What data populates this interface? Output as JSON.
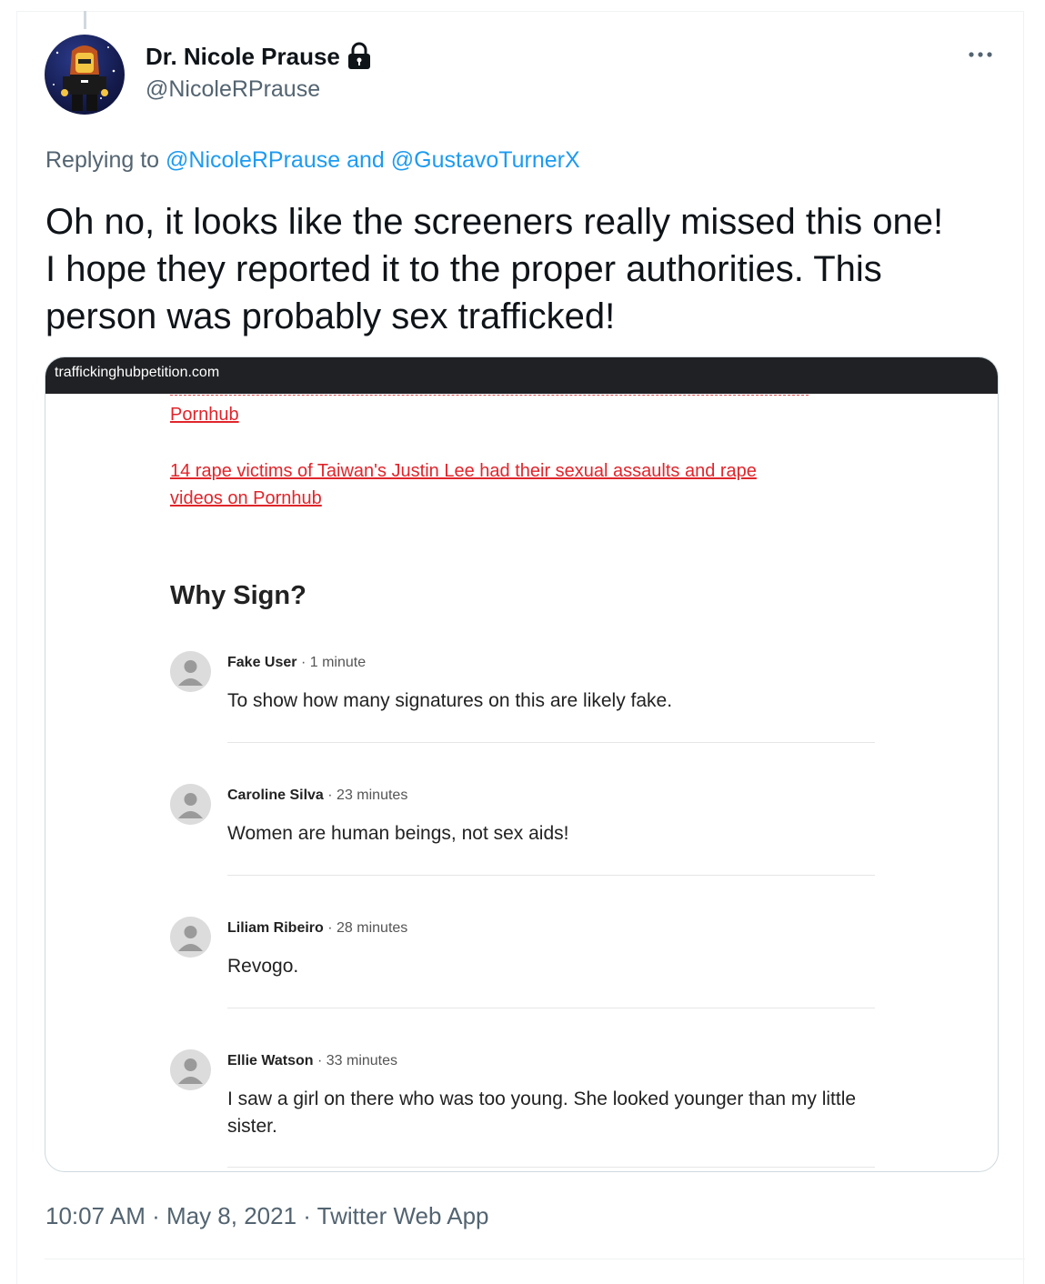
{
  "tweet": {
    "display_name": "Dr. Nicole Prause",
    "handle": "@NicoleRPrause",
    "replying_prefix": "Replying to",
    "replying_to": [
      "@NicoleRPrause",
      "@GustavoTurnerX"
    ],
    "replying_joiner": "and",
    "text": "Oh no, it looks like the screeners really missed this one!\nI hope they reported it to the proper authorities. This\nperson was probably sex trafficked!",
    "timestamp": "10:07 AM · May 8, 2021 · Twitter Web App",
    "accent_color": "#1d9bf0",
    "icons": [
      "lock-icon",
      "more-icon"
    ]
  },
  "media": {
    "url": "traffickinghubpetition.com",
    "links": [
      "Pornhub",
      "14 rape victims of Taiwan's Justin Lee had their sexual assaults and rape",
      "videos on Pornhub"
    ],
    "link_color": "#e0252b",
    "section_title": "Why Sign?",
    "comments": [
      {
        "name": "Fake User",
        "time": "· 1 minute",
        "text": "To show how many signatures on this are likely fake."
      },
      {
        "name": "Caroline Silva",
        "time": "· 23 minutes",
        "text": "Women are human beings, not sex aids!"
      },
      {
        "name": "Liliam Ribeiro",
        "time": "· 28 minutes",
        "text": "Revogo."
      },
      {
        "name": "Ellie Watson",
        "time": "· 33 minutes",
        "text": "I saw a girl on there who was too young. She looked younger than my little sister."
      }
    ]
  }
}
